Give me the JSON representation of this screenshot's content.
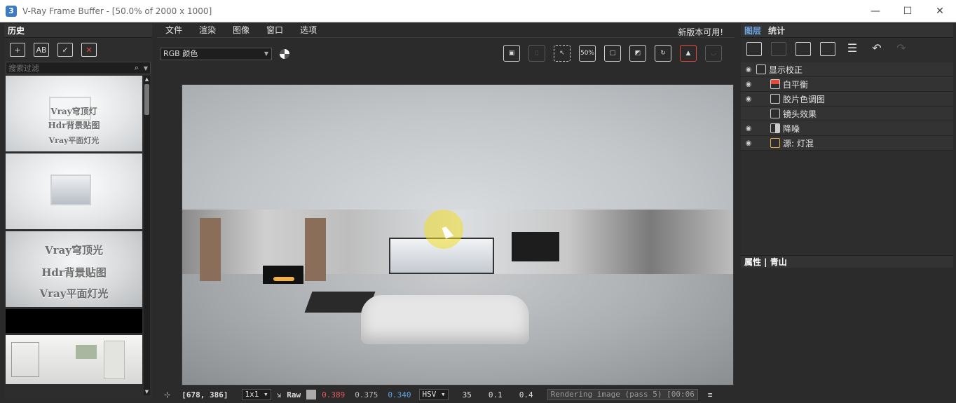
{
  "window": {
    "title": "V-Ray Frame Buffer - [50.0% of 2000 x 1000]",
    "minimize_glyph": "—",
    "maximize_glyph": "☐",
    "close_glyph": "✕"
  },
  "history": {
    "title": "历史",
    "search_placeholder": "搜索过滤",
    "thumbnails": [
      {
        "lines": [
          "Vray穹顶灯",
          "Hdr背景贴图",
          "Vray平面灯光"
        ]
      },
      {
        "lines": []
      },
      {
        "lines": [
          "Vray穹顶光",
          "Hdr背景贴图",
          "Vray平面灯光"
        ]
      },
      {
        "lines": []
      },
      {
        "lines": []
      }
    ]
  },
  "menu": {
    "items": [
      "文件",
      "渲染",
      "图像",
      "窗口",
      "选项"
    ],
    "new_version": "新版本可用!"
  },
  "toolbar": {
    "channel": "RGB 颜色",
    "zoom_label": "50%"
  },
  "status": {
    "coords": "[678, 386]",
    "scale": "1x1",
    "raw": "Raw",
    "r": "0.389",
    "g": "0.375",
    "b": "0.340",
    "mode": "HSV",
    "h": "35",
    "s": "0.1",
    "v": "0.4",
    "render": "Rendering image (pass 5) [00:06"
  },
  "right": {
    "tabs": [
      "图层",
      "统计"
    ],
    "layers": [
      {
        "label": "显示校正",
        "eye": true,
        "indent": 0
      },
      {
        "label": "白平衡",
        "eye": true,
        "indent": 1
      },
      {
        "label": "胶片色调图",
        "eye": true,
        "indent": 1
      },
      {
        "label": "镜头效果",
        "eye": false,
        "indent": 1
      },
      {
        "label": "降噪",
        "eye": true,
        "indent": 1
      },
      {
        "label": "源: 灯混",
        "eye": true,
        "indent": 1
      }
    ],
    "props_title": "属性 | 青山"
  }
}
